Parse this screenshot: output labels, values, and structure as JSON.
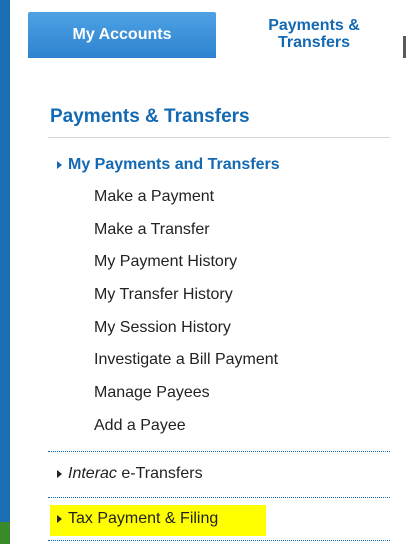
{
  "tabs": {
    "accounts_label": "My Accounts",
    "payments_line1": "Payments &",
    "payments_line2": "Transfers"
  },
  "section": {
    "title": "Payments & Transfers"
  },
  "group": {
    "label": "My Payments and Transfers",
    "items": [
      "Make a Payment",
      "Make a Transfer",
      "My Payment History",
      "My Transfer History",
      "My Session History",
      "Investigate a Bill Payment",
      "Manage Payees",
      "Add a Payee"
    ]
  },
  "interac": {
    "italic_part": "Interac",
    "rest": " e-Transfers"
  },
  "tax": {
    "label": "Tax Payment & Filing"
  },
  "colors": {
    "brand_blue": "#1469b3",
    "tab_blue": "#2d83cf",
    "highlight": "#ffff00",
    "accent_green": "#3a8a2a"
  }
}
